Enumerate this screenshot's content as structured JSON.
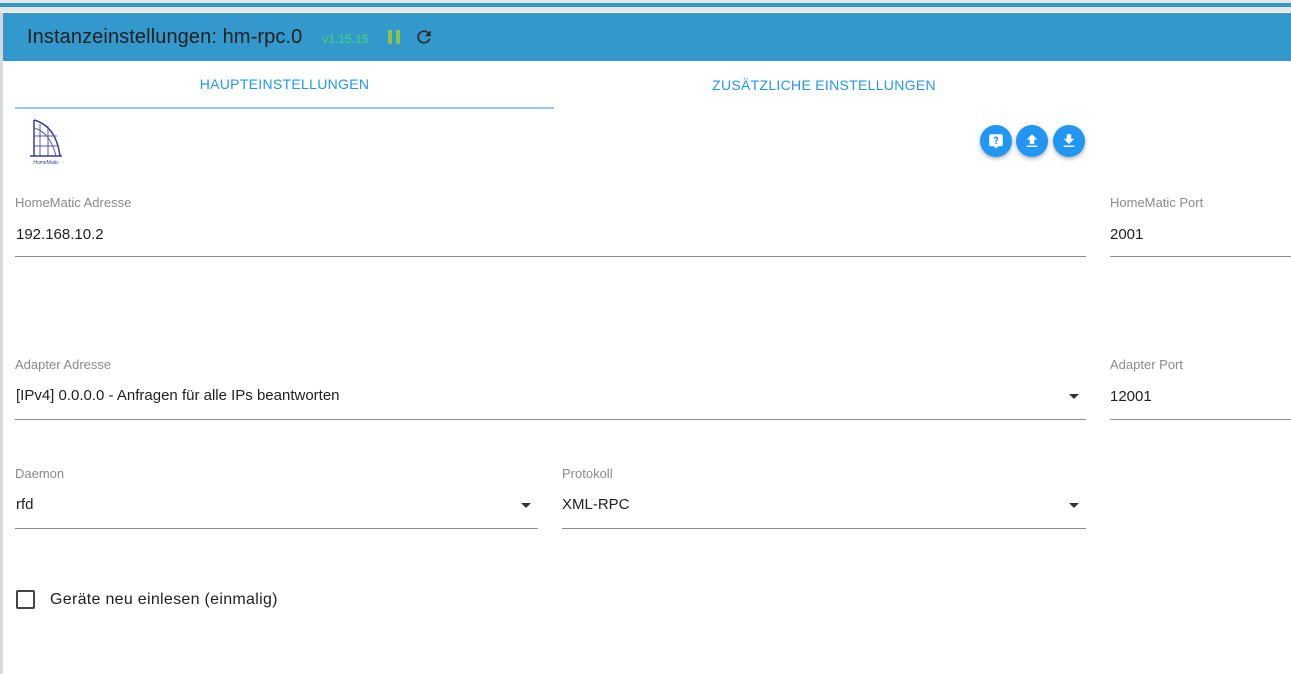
{
  "header": {
    "title": "Instanzeinstellungen: hm-rpc.0",
    "version": "v1.15.15",
    "pause_icon": "pause-icon",
    "reload_icon": "reload-icon",
    "color": "#3399cc"
  },
  "tabs": [
    {
      "label": "HAUPTEINSTELLUNGEN",
      "active": true
    },
    {
      "label": "ZUSÄTZLICHE EINSTELLUNGEN",
      "active": false
    }
  ],
  "logo": {
    "text": "HomeMatic"
  },
  "actions": [
    {
      "icon": "help-icon"
    },
    {
      "icon": "upload-icon"
    },
    {
      "icon": "download-icon"
    }
  ],
  "fields": {
    "homematic_address": {
      "label": "HomeMatic Adresse",
      "value": "192.168.10.2"
    },
    "homematic_port": {
      "label": "HomeMatic Port",
      "value": "2001"
    },
    "adapter_address": {
      "label": "Adapter Adresse",
      "value": "[IPv4] 0.0.0.0 - Anfragen für alle IPs beantworten"
    },
    "adapter_port": {
      "label": "Adapter Port",
      "value": "12001"
    },
    "daemon": {
      "label": "Daemon",
      "value": "rfd"
    },
    "protocol": {
      "label": "Protokoll",
      "value": "XML-RPC"
    }
  },
  "checkbox": {
    "label": "Geräte neu einlesen (einmalig)",
    "checked": false
  }
}
